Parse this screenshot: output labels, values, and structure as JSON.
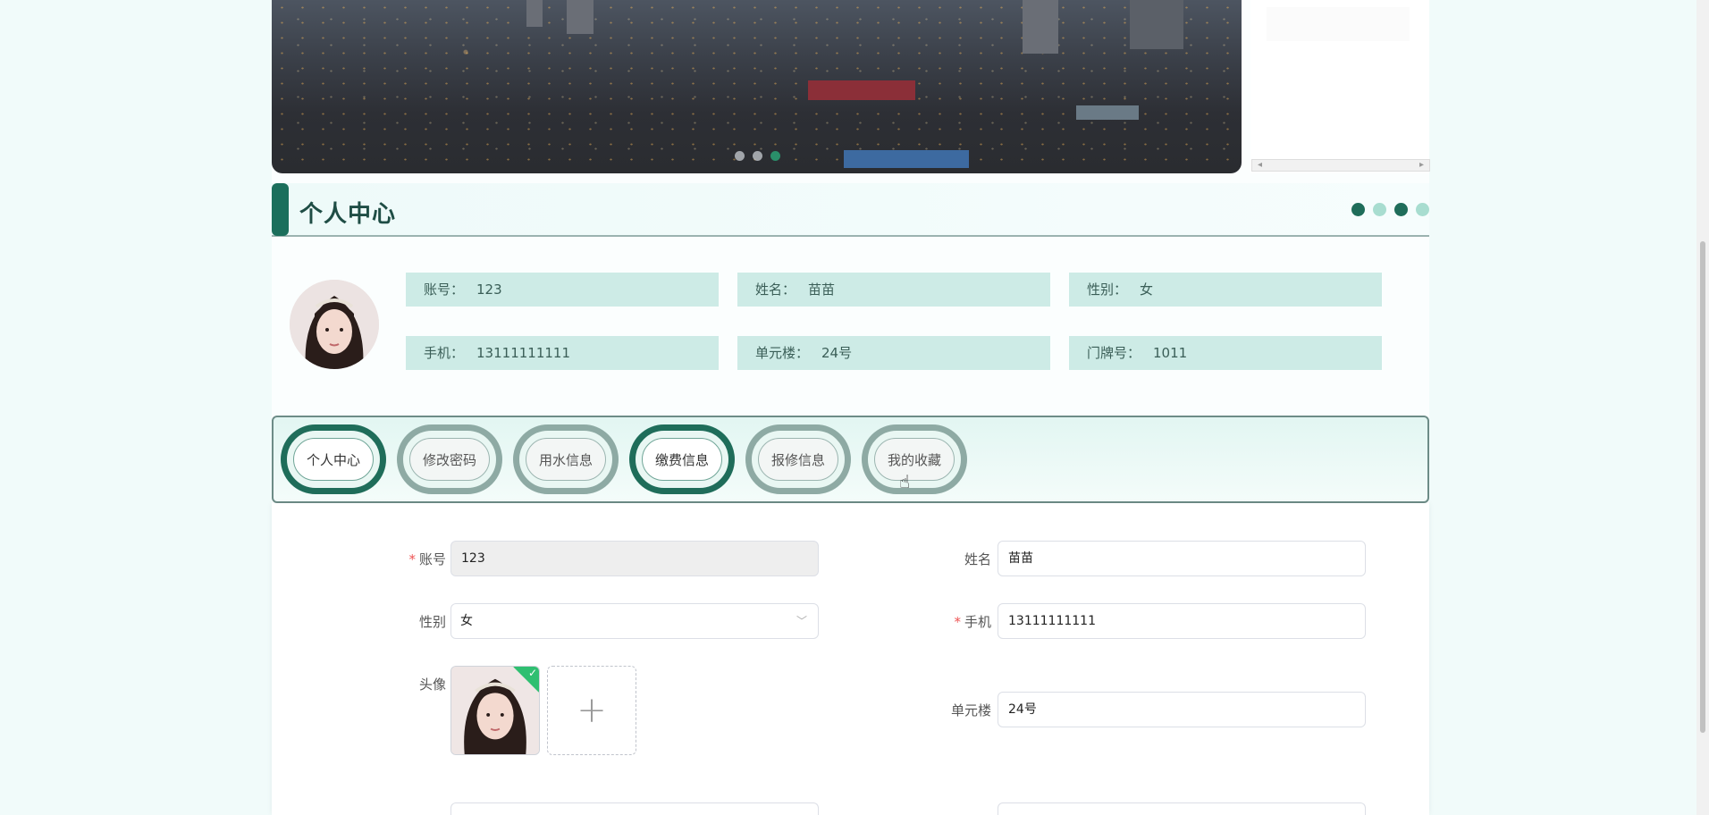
{
  "banner": {
    "slide_count": 3,
    "active_slide": 3
  },
  "section": {
    "title": "个人中心",
    "dot_colors": [
      "#1f6d5a",
      "#a8ddd0",
      "#1f6d5a",
      "#a8ddd0"
    ]
  },
  "profile_summary": [
    {
      "key": "账号：",
      "value": "123"
    },
    {
      "key": "姓名：",
      "value": "苗苗"
    },
    {
      "key": "性别：",
      "value": "女"
    },
    {
      "key": "手机：",
      "value": "13111111111"
    },
    {
      "key": "单元楼：",
      "value": "24号"
    },
    {
      "key": "门牌号：",
      "value": "1011"
    }
  ],
  "tabs": [
    {
      "label": "个人中心",
      "active": true
    },
    {
      "label": "修改密码",
      "active": false
    },
    {
      "label": "用水信息",
      "active": false
    },
    {
      "label": "缴费信息",
      "active": true
    },
    {
      "label": "报修信息",
      "active": false
    },
    {
      "label": "我的收藏",
      "active": false
    }
  ],
  "form": {
    "account": {
      "label": "账号",
      "required_mark": "*",
      "value": "123"
    },
    "name": {
      "label": "姓名",
      "value": "苗苗"
    },
    "gender": {
      "label": "性别",
      "value": "女"
    },
    "phone": {
      "label": "手机",
      "required_mark": "*",
      "value": "13111111111"
    },
    "avatar": {
      "label": "头像",
      "add_symbol": "+"
    },
    "building": {
      "label": "单元楼",
      "value": "24号"
    }
  },
  "icons": {
    "upload_success": "check-icon",
    "select_arrow": "chevron-down-icon",
    "scroll_left": "arrow-left-icon",
    "scroll_right": "arrow-right-icon"
  },
  "colors": {
    "primary": "#1f6d5a",
    "info_cell_bg": "#cdebe6",
    "required": "#e55555"
  }
}
